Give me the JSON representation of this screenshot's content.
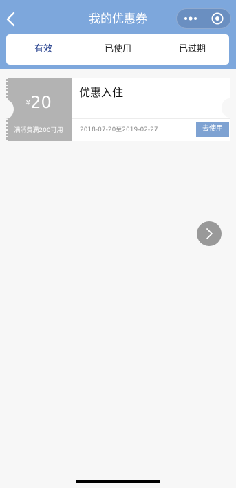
{
  "header": {
    "title": "我的优惠券",
    "back_icon": "chevron-left-icon",
    "more_icon": "more-dots-icon",
    "close_icon": "target-circle-icon",
    "bg_color": "#7da7dc"
  },
  "tabs": [
    {
      "label": "有效",
      "active": true
    },
    {
      "label": "已使用",
      "active": false
    },
    {
      "label": "已过期",
      "active": false
    }
  ],
  "coupon": {
    "currency": "¥",
    "amount": "20",
    "condition": "满消费满200可用",
    "name": "优惠入住",
    "validity": "2018-07-20至2019-02-27",
    "action": "去使用",
    "action_color": "#7ea2d2"
  },
  "floating_button": {
    "icon": "chevron-right-icon"
  }
}
